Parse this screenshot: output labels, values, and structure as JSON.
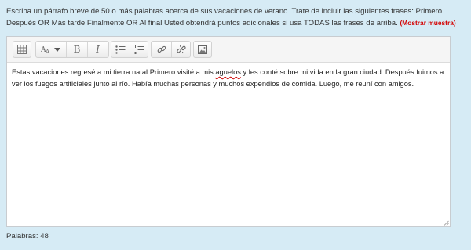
{
  "prompt": {
    "text": "Escriba un párrafo breve de 50 o más palabras acerca de sus vacaciones de verano. Trate de incluir las siguientes frases: Primero Después OR Más tarde Finalmente OR Al final Usted obtendrá puntos adicionales si usa TODAS las frases de arriba.",
    "sample_link": "(Mostrar muestra)"
  },
  "toolbar": {
    "buttons": [
      {
        "name": "toolbar-toggle",
        "icon": "grid-icon"
      },
      {
        "name": "font-size",
        "icon": "font-size-icon"
      },
      {
        "name": "bold",
        "label": "B"
      },
      {
        "name": "italic",
        "label": "I"
      },
      {
        "name": "unordered-list",
        "icon": "bullet-list-icon"
      },
      {
        "name": "ordered-list",
        "icon": "numbered-list-icon"
      },
      {
        "name": "link",
        "icon": "link-icon"
      },
      {
        "name": "unlink",
        "icon": "unlink-icon"
      },
      {
        "name": "image",
        "icon": "image-icon"
      }
    ]
  },
  "editor": {
    "before_misspelled": "Estas vacaciones regresé a mi tierra natal Primero visité a mis ",
    "misspelled_word": "aguelos",
    "after_misspelled": " y les conté sobre mi vida en la gran ciudad. Después fuimos a ver los fuegos artificiales junto al río. Había muchas personas y muchos expendios de comida. Luego, me reuní con amigos."
  },
  "word_count": "Palabras: 48",
  "colors": {
    "background": "#d6ebf5",
    "link_red": "#d40000",
    "spellcheck_red": "#cc0000"
  }
}
